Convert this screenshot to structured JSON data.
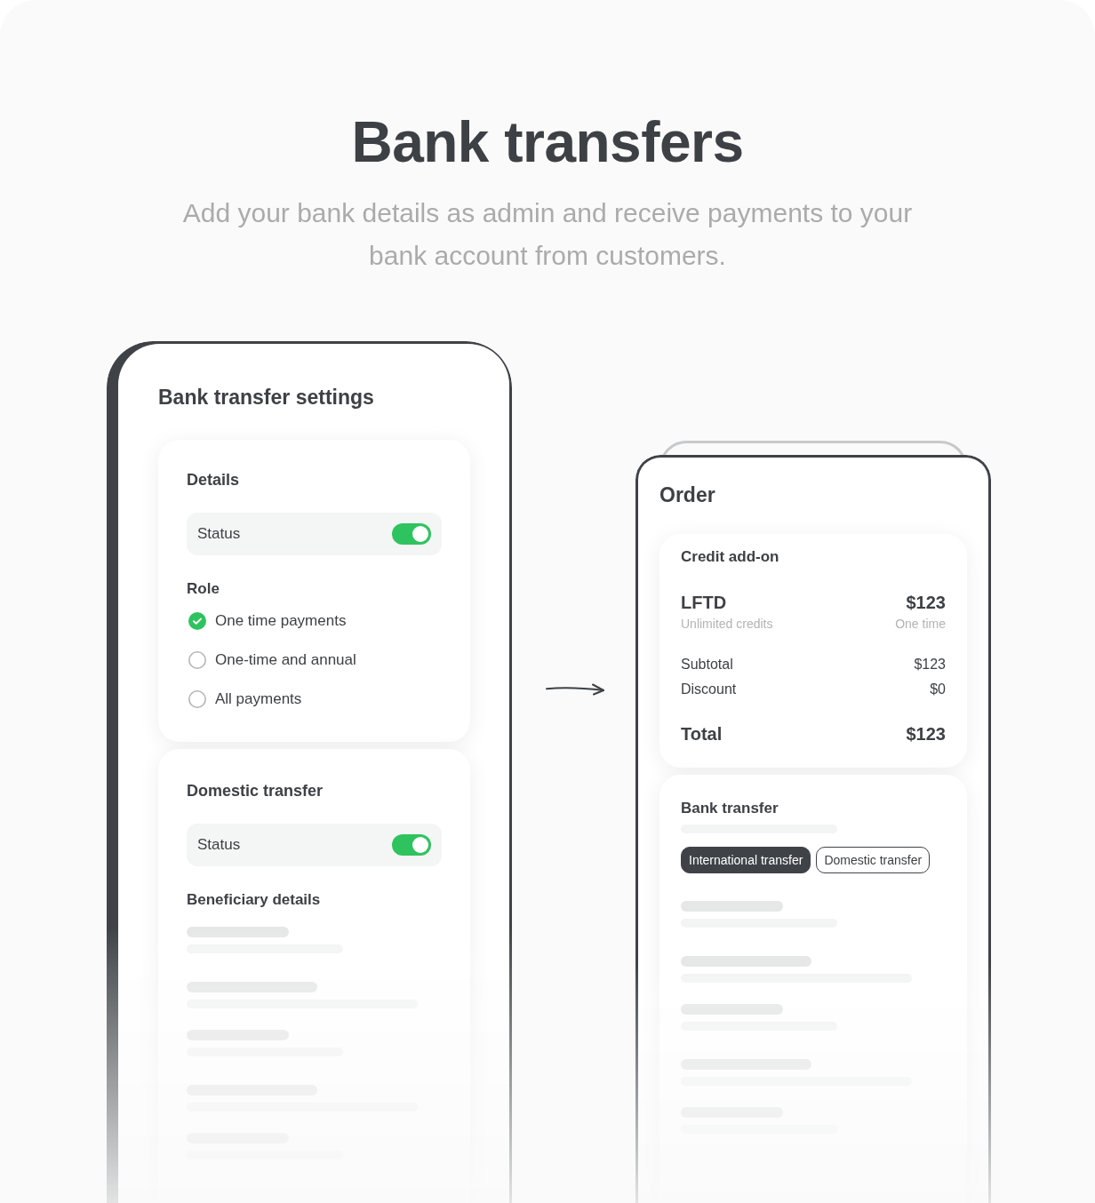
{
  "header": {
    "title": "Bank transfers",
    "subtitle": "Add your bank details as admin and receive payments to your bank account from customers."
  },
  "settings_panel": {
    "title": "Bank transfer settings",
    "details": {
      "title": "Details",
      "status": {
        "label": "Status",
        "on": true
      },
      "role": {
        "title": "Role",
        "options": [
          {
            "label": "One time payments",
            "selected": true
          },
          {
            "label": "One-time and annual",
            "selected": false
          },
          {
            "label": "All payments",
            "selected": false
          }
        ]
      }
    },
    "domestic_transfer": {
      "title": "Domestic transfer",
      "status": {
        "label": "Status",
        "on": true
      },
      "beneficiary": {
        "title": "Beneficiary details",
        "placeholder_rows": [
          {
            "kind": "short"
          },
          {
            "kind": "long"
          },
          {
            "kind": "short"
          },
          {
            "kind": "long"
          },
          {
            "kind": "short"
          }
        ]
      }
    }
  },
  "order_panel": {
    "title": "Order",
    "credit_addon": {
      "title": "Credit add-on",
      "product": {
        "name": "LFTD",
        "description": "Unlimited credits",
        "price": "$123",
        "billing": "One time"
      },
      "line_items": [
        {
          "label": "Subtotal",
          "amount": "$123"
        },
        {
          "label": "Discount",
          "amount": "$0"
        }
      ],
      "total": {
        "label": "Total",
        "amount": "$123"
      }
    },
    "bank_transfer": {
      "title": "Bank transfer",
      "description_placeholder": true,
      "tabs": [
        {
          "label": "International transfer",
          "selected": true
        },
        {
          "label": "Domestic transfer",
          "selected": false
        }
      ],
      "placeholder_rows": [
        {
          "kind": "short"
        },
        {
          "kind": "long"
        },
        {
          "kind": "short"
        },
        {
          "kind": "long"
        },
        {
          "kind": "short"
        }
      ]
    }
  }
}
